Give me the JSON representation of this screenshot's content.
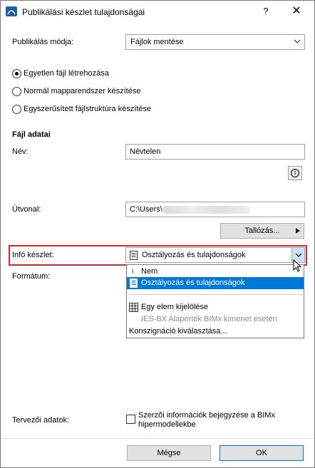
{
  "window": {
    "title": "Publikálási készlet tulajdonságai",
    "help": "?",
    "close": "✕"
  },
  "publish_mode": {
    "label": "Publikálás módja:",
    "value": "Fájlok mentése"
  },
  "options": [
    {
      "label": "Egyetlen fájl létrehozása",
      "selected": true
    },
    {
      "label": "Normál mapparendszer készítése",
      "selected": false
    },
    {
      "label": "Egyszerűsített fájlstruktúra készítése",
      "selected": false
    }
  ],
  "file_data": {
    "heading": "Fájl adatai",
    "name_label": "Név:",
    "name_value": "Névtelen",
    "path_label": "Útvonal:",
    "path_value": "C:\\Users\\",
    "browse_label": "Tallózás...",
    "info_icon": "i"
  },
  "info_set": {
    "label": "Infó készlet:",
    "value": "Osztályozás és tulajdonságok",
    "menu": {
      "none": "Nem",
      "classification": "Osztályozás és tulajdonságok",
      "select_one": "Egy elem kijelölése",
      "ies_default": "IES-BX Alapérték BIMx kimenet esetén",
      "choose": "Konszignáció kiválasztása..."
    }
  },
  "format_label": "Formátum:",
  "designer": {
    "label": "Tervezői adatok:",
    "checkbox_text_1": "Szerzői információk bejegyzése a BIMx",
    "checkbox_text_2": "hipermodellekbe",
    "checked": false
  },
  "footer": {
    "cancel": "Mégse",
    "ok": "OK"
  },
  "colors": {
    "accent": "#0078d7",
    "highlight": "#e0242b"
  }
}
